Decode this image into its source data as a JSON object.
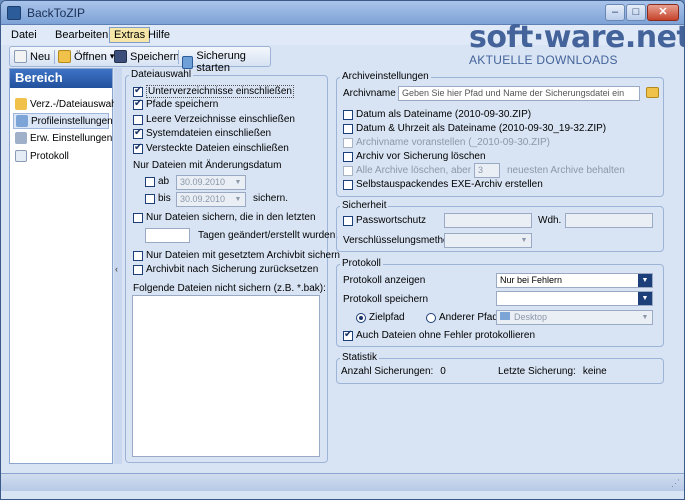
{
  "window": {
    "title": "BackToZIP",
    "controls": {
      "minimize": "–",
      "maximize": "□",
      "close": "✕"
    }
  },
  "menu": [
    "Datei",
    "Bearbeiten",
    "Extras",
    "Hilfe"
  ],
  "toolbar": {
    "new": "Neu",
    "open": "Öffnen",
    "open_arrow": "▾",
    "save": "Speichern",
    "start": "Sicherung starten"
  },
  "brand": {
    "name": "soft·ware.net",
    "tagline": "AKTUELLE DOWNLOADS"
  },
  "sidebar": {
    "header": "Bereich",
    "items": [
      {
        "label": "Verz.-/Dateiauswahl",
        "icon": "folder-icon"
      },
      {
        "label": "Profileinstellungen",
        "icon": "profile-icon",
        "selected": true
      },
      {
        "label": "Erw. Einstellungen",
        "icon": "settings-icon"
      },
      {
        "label": "Protokoll",
        "icon": "log-icon"
      }
    ],
    "collapse_arrow": "‹"
  },
  "dateiauswahl": {
    "legend": "Dateiauswahl",
    "unterverz": "Unterverzeichnisse einschließen",
    "pfade": "Pfade speichern",
    "leere": "Leere Verzeichnisse einschließen",
    "system": "Systemdateien einschließen",
    "versteckt": "Versteckte Dateien einschließen",
    "nur_aenderung": "Nur Dateien mit Änderungsdatum",
    "ab": "ab",
    "ab_date": "30.09.2010",
    "bis": "bis",
    "bis_date": "30.09.2010",
    "sichern": "sichern.",
    "letzten": "Nur Dateien sichern, die in den letzten",
    "tage": "Tagen geändert/erstellt wurden.",
    "archivbit": "Nur Dateien mit gesetztem Archivbit sichern",
    "archivbit_reset": "Archivbit nach Sicherung zurücksetzen",
    "exclude_label": "Folgende Dateien nicht sichern (z.B. *.bak):"
  },
  "archiv": {
    "legend": "Archiveinstellungen",
    "name_label": "Archivname",
    "name_placeholder": "Geben Sie hier Pfad und Name der Sicherungsdatei ein",
    "datum": "Datum als Dateiname (2010-09-30.ZIP)",
    "datum_zeit": "Datum & Uhrzeit als Dateiname (2010-09-30_19-32.ZIP)",
    "voranstellen": "Archivname voranstellen (_2010-09-30.ZIP)",
    "loeschen": "Archiv vor Sicherung löschen",
    "alle_loeschen": "Alle Archive löschen, aber die",
    "anzahl": "3",
    "neueste": "neuesten Archive behalten",
    "exe": "Selbstauspackendes EXE-Archiv erstellen"
  },
  "sicherheit": {
    "legend": "Sicherheit",
    "passwort": "Passwortschutz",
    "wdh": "Wdh.",
    "methode": "Verschlüsselungsmethode"
  },
  "protokoll": {
    "legend": "Protokoll",
    "anzeigen": "Protokoll anzeigen",
    "anzeigen_value": "Nur bei Fehlern",
    "speichern": "Protokoll speichern",
    "zielpfad": "Zielpfad",
    "anderer": "Anderer Pfad",
    "desktop": "Desktop",
    "auch_ohne": "Auch Dateien ohne Fehler protokollieren"
  },
  "statistik": {
    "legend": "Statistik",
    "anzahl_label": "Anzahl Sicherungen:",
    "anzahl_value": "0",
    "letzte_label": "Letzte Sicherung:",
    "letzte_value": "keine"
  },
  "colors": {
    "accent": "#22519d",
    "brand": "#43639a",
    "frame": "#d8e4f4"
  }
}
